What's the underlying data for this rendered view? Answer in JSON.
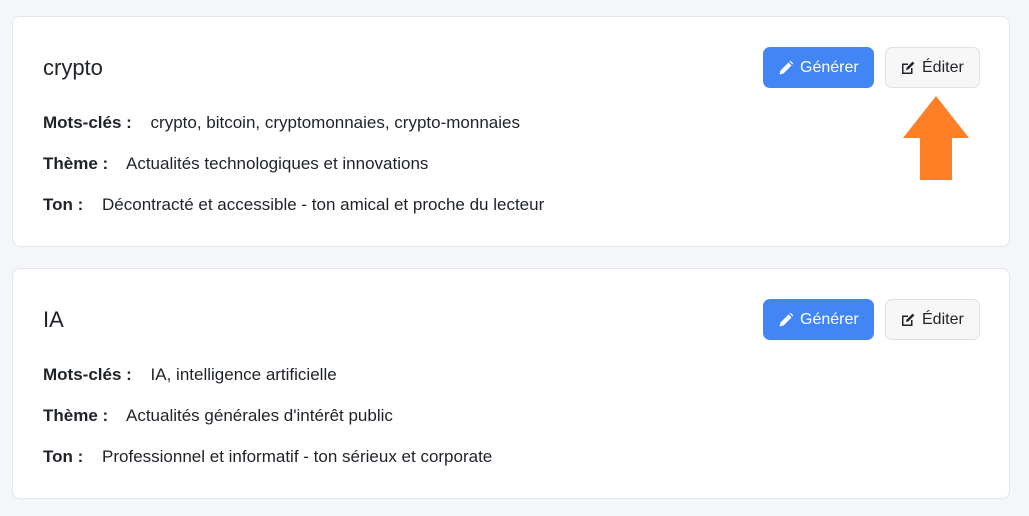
{
  "colors": {
    "primary": "#4285f4",
    "arrow": "#ff7f27",
    "background": "#f5f6f8",
    "card": "#ffffff"
  },
  "labels": {
    "keywords": "Mots-clés :",
    "theme": "Thème :",
    "tone": "Ton :"
  },
  "cards": [
    {
      "title": "crypto",
      "generate_label": "Générer",
      "edit_label": "Éditer",
      "keywords": "crypto, bitcoin, cryptomonnaies, crypto-monnaies",
      "theme": "Actualités technologiques et innovations",
      "tone": "Décontracté et accessible - ton amical et proche du lecteur"
    },
    {
      "title": "IA",
      "generate_label": "Générer",
      "edit_label": "Éditer",
      "keywords": "IA, intelligence artificielle",
      "theme": "Actualités générales d'intérêt public",
      "tone": "Professionnel et informatif - ton sérieux et corporate"
    }
  ],
  "icons": {
    "generate": "pencil-icon",
    "edit": "edit-square-icon",
    "annotation": "arrow-up-icon"
  }
}
